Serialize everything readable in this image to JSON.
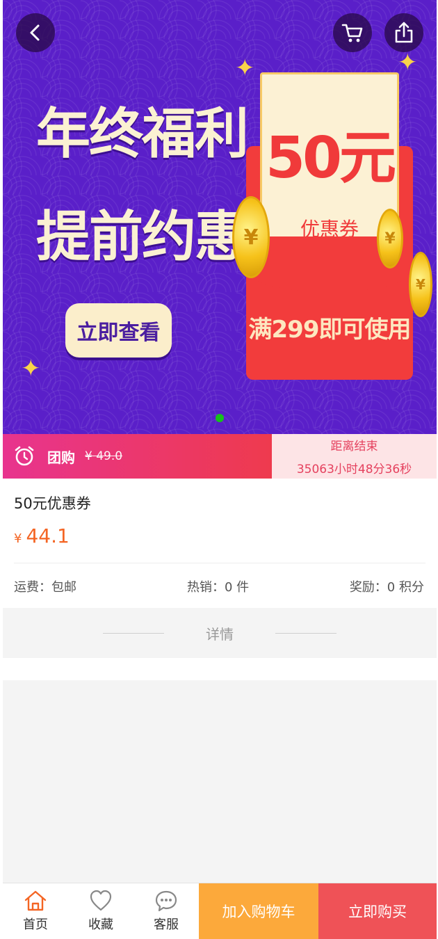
{
  "banner": {
    "headline_line1": "年终福利",
    "headline_line2": "提前约惠",
    "view_button": "立即查看",
    "coupon_amount": "50元",
    "coupon_label": "优惠券",
    "usage_condition": "满299即可使用",
    "coin_symbol": "¥",
    "active_slide_color": "#16c11c"
  },
  "header": {
    "back_icon": "chevron-left-icon",
    "cart_icon": "cart-icon",
    "share_icon": "share-icon"
  },
  "group_buy": {
    "label": "团购",
    "original_price": "¥ 49.0",
    "countdown_title": "距离结束",
    "countdown_value": "35063小时48分36秒",
    "accent_color": "#e8348e"
  },
  "product": {
    "title": "50元优惠券",
    "currency": "¥",
    "price": "44.1",
    "shipping": "运费：包邮",
    "sales": "热销：0 件",
    "points": "奖励：0 积分",
    "price_color": "#f46524"
  },
  "details": {
    "heading": "详情"
  },
  "bottom_bar": {
    "home_label": "首页",
    "favorite_label": "收藏",
    "service_label": "客服",
    "add_to_cart": "加入购物车",
    "buy_now": "立即购买",
    "cart_color": "#fca93b",
    "buy_color": "#ef5257"
  }
}
